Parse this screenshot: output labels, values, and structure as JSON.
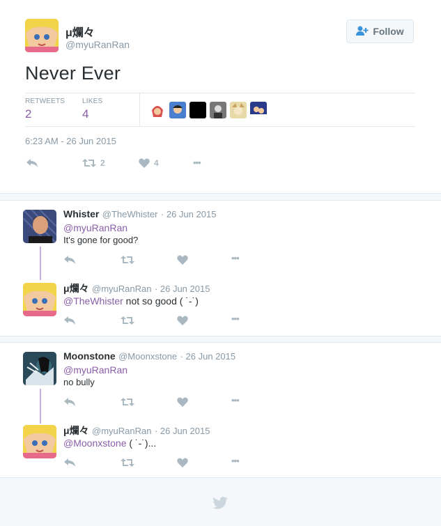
{
  "main_tweet": {
    "author_name": "μ爛々",
    "author_handle": "@myuRanRan",
    "follow_label": "Follow",
    "text": "Never Ever",
    "retweets_label": "RETWEETS",
    "retweets_count": "2",
    "likes_label": "LIKES",
    "likes_count": "4",
    "timestamp": "6:23 AM - 26 Jun 2015",
    "action_retweet_count": "2",
    "action_like_count": "4",
    "more_glyph": "•••"
  },
  "replies": [
    {
      "name": "Whister",
      "handle": "@TheWhister",
      "date": "· 26 Jun 2015",
      "mention": "@myuRanRan",
      "text": "It's gone for good?"
    },
    {
      "name": "μ爛々",
      "handle": "@myuRanRan",
      "date": "· 26 Jun 2015",
      "mention": "@TheWhister",
      "text": " not so good ( ˙-˙)"
    },
    {
      "name": "Moonstone",
      "handle": "@Moonxstone",
      "date": "· 26 Jun 2015",
      "mention": "@myuRanRan",
      "text": "no bully"
    },
    {
      "name": "μ爛々",
      "handle": "@myuRanRan",
      "date": "· 26 Jun 2015",
      "mention": "@Moonxstone",
      "text": " ( ˙-˙)..."
    }
  ],
  "colors": {
    "accent": "#8a5ea8",
    "muted": "#8899a6",
    "icon": "#aab8c2",
    "thread_line": "#c9aee0"
  }
}
